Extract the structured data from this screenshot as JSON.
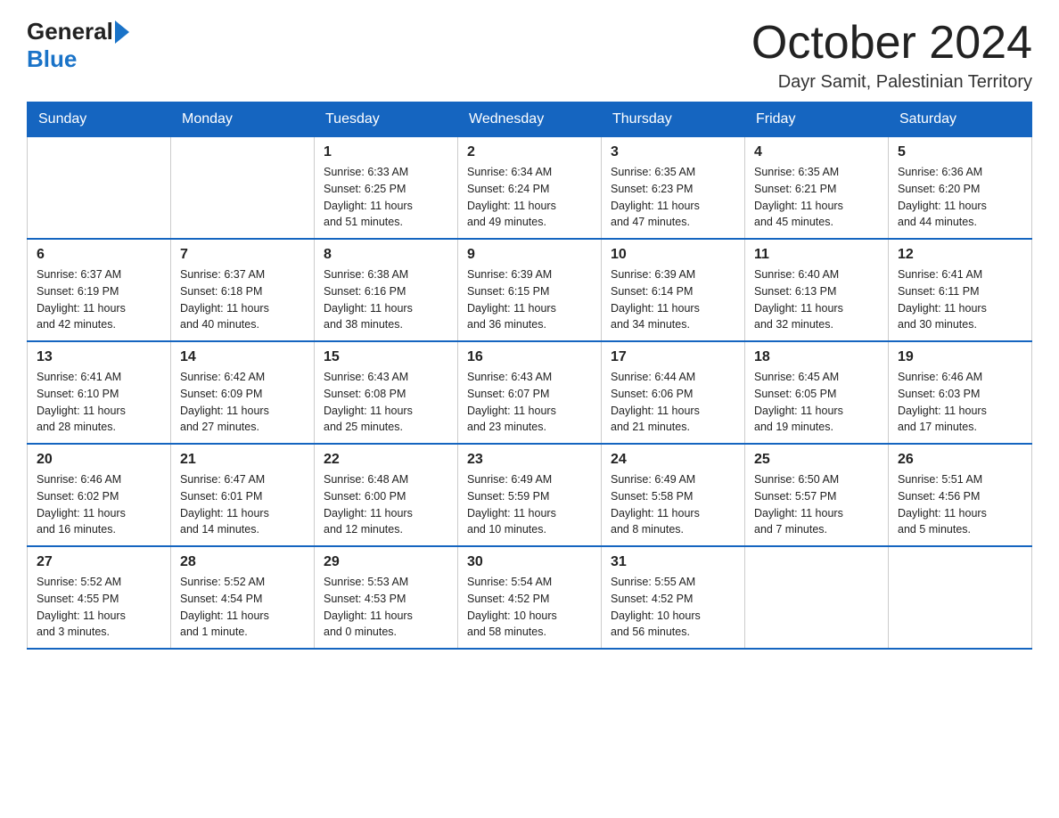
{
  "header": {
    "logo_general": "General",
    "logo_blue": "Blue",
    "month_title": "October 2024",
    "location": "Dayr Samit, Palestinian Territory"
  },
  "days_of_week": [
    "Sunday",
    "Monday",
    "Tuesday",
    "Wednesday",
    "Thursday",
    "Friday",
    "Saturday"
  ],
  "weeks": [
    [
      {
        "day": "",
        "info": ""
      },
      {
        "day": "",
        "info": ""
      },
      {
        "day": "1",
        "info": "Sunrise: 6:33 AM\nSunset: 6:25 PM\nDaylight: 11 hours\nand 51 minutes."
      },
      {
        "day": "2",
        "info": "Sunrise: 6:34 AM\nSunset: 6:24 PM\nDaylight: 11 hours\nand 49 minutes."
      },
      {
        "day": "3",
        "info": "Sunrise: 6:35 AM\nSunset: 6:23 PM\nDaylight: 11 hours\nand 47 minutes."
      },
      {
        "day": "4",
        "info": "Sunrise: 6:35 AM\nSunset: 6:21 PM\nDaylight: 11 hours\nand 45 minutes."
      },
      {
        "day": "5",
        "info": "Sunrise: 6:36 AM\nSunset: 6:20 PM\nDaylight: 11 hours\nand 44 minutes."
      }
    ],
    [
      {
        "day": "6",
        "info": "Sunrise: 6:37 AM\nSunset: 6:19 PM\nDaylight: 11 hours\nand 42 minutes."
      },
      {
        "day": "7",
        "info": "Sunrise: 6:37 AM\nSunset: 6:18 PM\nDaylight: 11 hours\nand 40 minutes."
      },
      {
        "day": "8",
        "info": "Sunrise: 6:38 AM\nSunset: 6:16 PM\nDaylight: 11 hours\nand 38 minutes."
      },
      {
        "day": "9",
        "info": "Sunrise: 6:39 AM\nSunset: 6:15 PM\nDaylight: 11 hours\nand 36 minutes."
      },
      {
        "day": "10",
        "info": "Sunrise: 6:39 AM\nSunset: 6:14 PM\nDaylight: 11 hours\nand 34 minutes."
      },
      {
        "day": "11",
        "info": "Sunrise: 6:40 AM\nSunset: 6:13 PM\nDaylight: 11 hours\nand 32 minutes."
      },
      {
        "day": "12",
        "info": "Sunrise: 6:41 AM\nSunset: 6:11 PM\nDaylight: 11 hours\nand 30 minutes."
      }
    ],
    [
      {
        "day": "13",
        "info": "Sunrise: 6:41 AM\nSunset: 6:10 PM\nDaylight: 11 hours\nand 28 minutes."
      },
      {
        "day": "14",
        "info": "Sunrise: 6:42 AM\nSunset: 6:09 PM\nDaylight: 11 hours\nand 27 minutes."
      },
      {
        "day": "15",
        "info": "Sunrise: 6:43 AM\nSunset: 6:08 PM\nDaylight: 11 hours\nand 25 minutes."
      },
      {
        "day": "16",
        "info": "Sunrise: 6:43 AM\nSunset: 6:07 PM\nDaylight: 11 hours\nand 23 minutes."
      },
      {
        "day": "17",
        "info": "Sunrise: 6:44 AM\nSunset: 6:06 PM\nDaylight: 11 hours\nand 21 minutes."
      },
      {
        "day": "18",
        "info": "Sunrise: 6:45 AM\nSunset: 6:05 PM\nDaylight: 11 hours\nand 19 minutes."
      },
      {
        "day": "19",
        "info": "Sunrise: 6:46 AM\nSunset: 6:03 PM\nDaylight: 11 hours\nand 17 minutes."
      }
    ],
    [
      {
        "day": "20",
        "info": "Sunrise: 6:46 AM\nSunset: 6:02 PM\nDaylight: 11 hours\nand 16 minutes."
      },
      {
        "day": "21",
        "info": "Sunrise: 6:47 AM\nSunset: 6:01 PM\nDaylight: 11 hours\nand 14 minutes."
      },
      {
        "day": "22",
        "info": "Sunrise: 6:48 AM\nSunset: 6:00 PM\nDaylight: 11 hours\nand 12 minutes."
      },
      {
        "day": "23",
        "info": "Sunrise: 6:49 AM\nSunset: 5:59 PM\nDaylight: 11 hours\nand 10 minutes."
      },
      {
        "day": "24",
        "info": "Sunrise: 6:49 AM\nSunset: 5:58 PM\nDaylight: 11 hours\nand 8 minutes."
      },
      {
        "day": "25",
        "info": "Sunrise: 6:50 AM\nSunset: 5:57 PM\nDaylight: 11 hours\nand 7 minutes."
      },
      {
        "day": "26",
        "info": "Sunrise: 5:51 AM\nSunset: 4:56 PM\nDaylight: 11 hours\nand 5 minutes."
      }
    ],
    [
      {
        "day": "27",
        "info": "Sunrise: 5:52 AM\nSunset: 4:55 PM\nDaylight: 11 hours\nand 3 minutes."
      },
      {
        "day": "28",
        "info": "Sunrise: 5:52 AM\nSunset: 4:54 PM\nDaylight: 11 hours\nand 1 minute."
      },
      {
        "day": "29",
        "info": "Sunrise: 5:53 AM\nSunset: 4:53 PM\nDaylight: 11 hours\nand 0 minutes."
      },
      {
        "day": "30",
        "info": "Sunrise: 5:54 AM\nSunset: 4:52 PM\nDaylight: 10 hours\nand 58 minutes."
      },
      {
        "day": "31",
        "info": "Sunrise: 5:55 AM\nSunset: 4:52 PM\nDaylight: 10 hours\nand 56 minutes."
      },
      {
        "day": "",
        "info": ""
      },
      {
        "day": "",
        "info": ""
      }
    ]
  ]
}
